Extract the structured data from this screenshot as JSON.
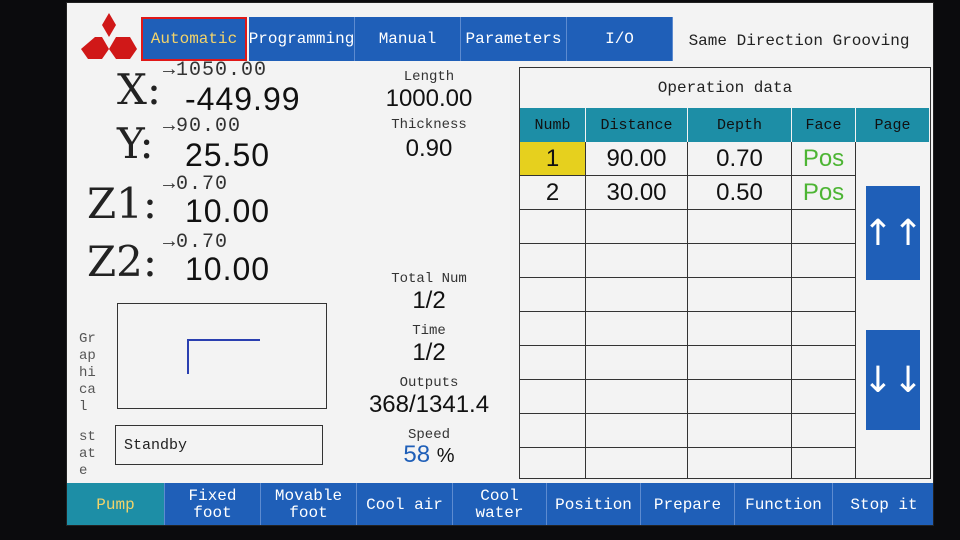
{
  "tabs": [
    "Automatic",
    "Programming",
    "Manual",
    "Parameters",
    "I/O"
  ],
  "mode_title": "Same Direction Grooving",
  "axes": [
    {
      "label": "X:",
      "target": "→1050.00",
      "value": "-449.99"
    },
    {
      "label": "Y:",
      "target": "→90.00",
      "value": "25.50"
    },
    {
      "label": "Z1:",
      "target": "→0.70",
      "value": "10.00"
    },
    {
      "label": "Z2:",
      "target": "→0.70",
      "value": "10.00"
    }
  ],
  "length": {
    "label": "Length",
    "value": "1000.00"
  },
  "thickness": {
    "label": "Thickness",
    "value": "0.90"
  },
  "total_num": {
    "label": "Total Num",
    "value": "1/2"
  },
  "time": {
    "label": "Time",
    "value": "1/2"
  },
  "outputs": {
    "label": "Outputs",
    "value": "368/1341.4"
  },
  "speed": {
    "label": "Speed",
    "value": "58",
    "unit": "%"
  },
  "graphical_label": "Graphical",
  "state_label": "state",
  "state_value": "Standby",
  "operation": {
    "title": "Operation data",
    "headers": [
      "Numb",
      "Distance",
      "Depth",
      "Face",
      "Page"
    ],
    "rows": [
      {
        "numb": "1",
        "distance": "90.00",
        "depth": "0.70",
        "face": "Pos"
      },
      {
        "numb": "2",
        "distance": "30.00",
        "depth": "0.50",
        "face": "Pos"
      }
    ],
    "page_up": "↑↑",
    "page_down": "↓↓"
  },
  "bottom_buttons": [
    "Pump",
    "Fixed foot",
    "Movable foot",
    "Cool air",
    "Cool water",
    "Position",
    "Prepare",
    "Function",
    "Stop it"
  ],
  "colors": {
    "button_blue": "#1f5fb8",
    "teal": "#1d8ea6",
    "selected_yellow": "#e6d01e",
    "face_green": "#4db534",
    "active_tab_border": "#e01818"
  }
}
